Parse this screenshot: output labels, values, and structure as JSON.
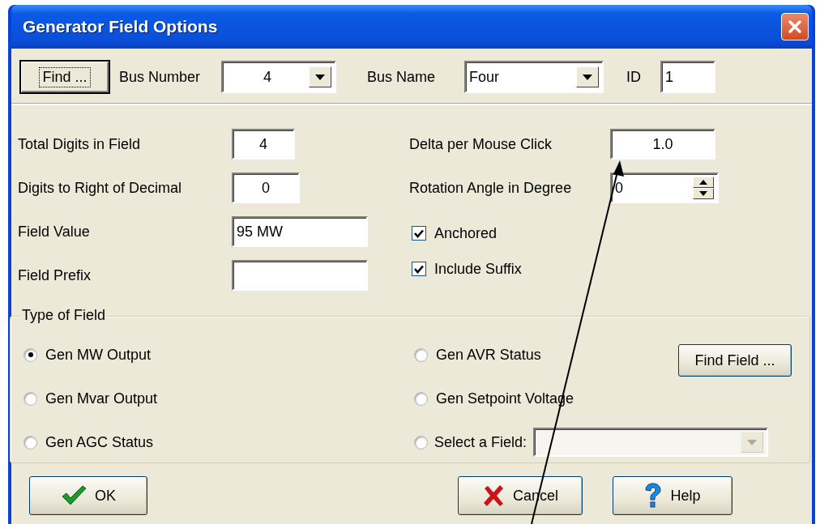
{
  "window": {
    "title": "Generator Field Options"
  },
  "bus": {
    "find_button": {
      "label": "Find ...",
      "focused": true
    },
    "bus_number_label": "Bus Number",
    "bus_number": "4",
    "bus_name_label": "Bus Name",
    "bus_name": "Four",
    "id_label": "ID",
    "id": "1"
  },
  "left_fields": [
    {
      "label": "Total Digits in Field",
      "value": "4"
    },
    {
      "label": "Digits to Right of Decimal",
      "value": "0"
    },
    {
      "label": "Field Value",
      "value": "95 MW"
    },
    {
      "label": "Field Prefix"
    }
  ],
  "right_fields": [
    {
      "label": "Delta per Mouse Click",
      "value": "1.0",
      "kind": "text"
    },
    {
      "label": "Rotation Angle in Degree",
      "value": "0",
      "kind": "spinner"
    }
  ],
  "checkboxes": [
    {
      "label": "Anchored",
      "checked": true
    },
    {
      "label": "Include Suffix",
      "checked": true
    }
  ],
  "type_of_field": {
    "title": "Type of Field",
    "options": [
      {
        "label": "Gen MW Output",
        "selected": true
      },
      {
        "label": "Gen AVR Status",
        "selected": false
      },
      {
        "label": "Gen Mvar Output",
        "selected": false
      },
      {
        "label": "Gen Setpoint Voltage",
        "selected": false
      },
      {
        "label": "Gen AGC Status",
        "selected": false
      },
      {
        "label": "Select a Field:",
        "selected": false
      }
    ],
    "find_field_button": "Find Field ...",
    "select_field": {
      "disabled": true
    }
  },
  "buttons": [
    {
      "label": "OK",
      "kind": "ok"
    },
    {
      "label": "Cancel",
      "kind": "cancel"
    },
    {
      "label": "Help",
      "kind": "help"
    }
  ]
}
